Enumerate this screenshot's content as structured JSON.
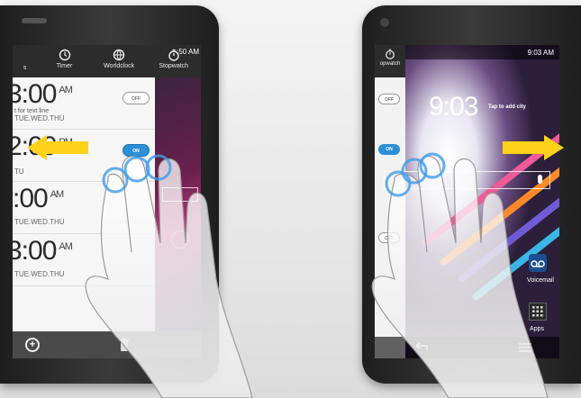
{
  "left_phone": {
    "status_time": ":50 AM",
    "tabs": [
      {
        "label": "s",
        "icon": "alarm-icon"
      },
      {
        "label": "Timer",
        "icon": "timer-icon"
      },
      {
        "label": "Worldclock",
        "icon": "worldclock-icon"
      },
      {
        "label": "Stopwatch",
        "icon": "stopwatch-icon"
      }
    ],
    "alarms": [
      {
        "time": "3:00",
        "ampm": "AM",
        "sub": "t for text line",
        "days": "TUE.WED.THU",
        "state": "OFF"
      },
      {
        "time": "2:00",
        "ampm": "PM",
        "sub": "",
        "days": "TU",
        "state": "ON"
      },
      {
        "time": ":00",
        "ampm": "AM",
        "sub": "",
        "days": "TUE.WED.THU",
        "state": ""
      },
      {
        "time": "3:00",
        "ampm": "AM",
        "sub": "",
        "days": "TUE.WED.THU",
        "state": ""
      }
    ]
  },
  "right_phone": {
    "status_time": "9:03 AM",
    "panel_tab_label": "opwatch",
    "panel_toggle_top": "OFF",
    "panel_toggle_mid": "ON",
    "panel_toggle_low": "OFF",
    "clock": "9:03",
    "tap_city": "Tap to add city",
    "voicemail_label": "Voicemail",
    "apps_label": "Apps"
  },
  "colors": {
    "arrow": "#ffd21a",
    "toggle_on": "#2b8fd6",
    "bubble": "#3d9be9"
  }
}
